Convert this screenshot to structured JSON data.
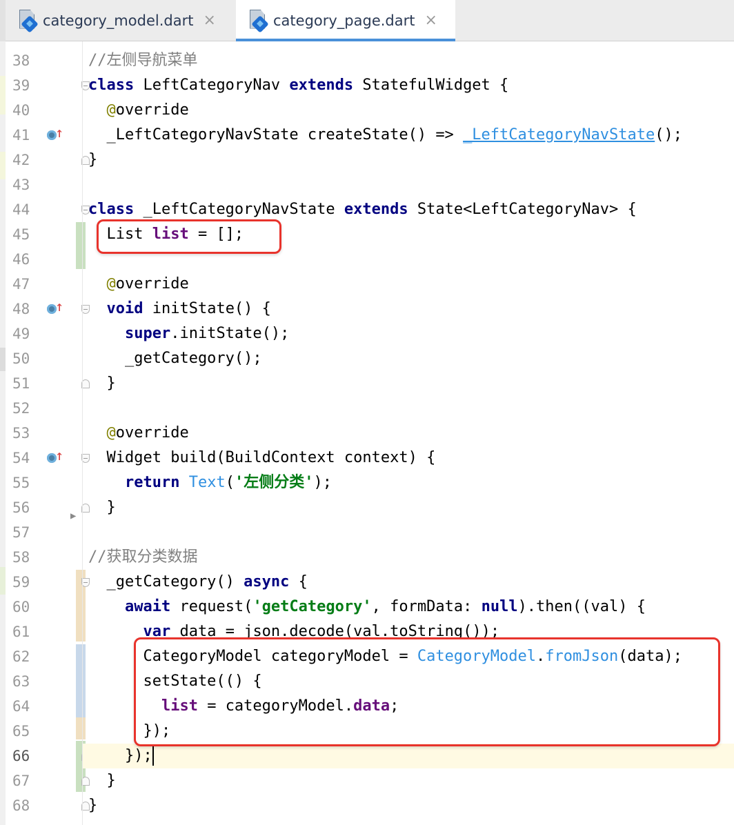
{
  "tabs": [
    {
      "label": "category_model.dart",
      "close": "×",
      "icon": "dart-file-icon",
      "active": false
    },
    {
      "label": "category_page.dart",
      "close": "×",
      "icon": "dart-file-icon",
      "active": true
    }
  ],
  "colors": {
    "keyword": "#000080",
    "comment": "#808080",
    "string": "#067d17",
    "annotation": "#808000",
    "field": "#660e7a",
    "link": "#2f8fe0",
    "highlight_box": "#e8332c",
    "current_line": "#fffae3",
    "tab_underline": "#4a90d9"
  },
  "current_line": 66,
  "highlight_boxes": [
    {
      "lines": [
        45,
        45
      ],
      "note": "List list = [];"
    },
    {
      "lines": [
        62,
        65
      ],
      "note": "setState block"
    }
  ],
  "gutter_markers": [
    41,
    48,
    54
  ],
  "lines": [
    {
      "n": "38",
      "segs": [
        {
          "t": "//左侧导航菜单",
          "c": "com"
        }
      ]
    },
    {
      "n": "39",
      "segs": [
        {
          "t": "class",
          "c": "kw"
        },
        {
          "t": " LeftCategoryNav "
        },
        {
          "t": "extends",
          "c": "kw"
        },
        {
          "t": " StatefulWidget {"
        }
      ]
    },
    {
      "n": "40",
      "segs": [
        {
          "t": "  "
        },
        {
          "t": "@",
          "c": "ann"
        },
        {
          "t": "override"
        }
      ]
    },
    {
      "n": "41",
      "segs": [
        {
          "t": "  _LeftCategoryNavState createState() => "
        },
        {
          "t": "_LeftCategoryNavState",
          "c": "linku"
        },
        {
          "t": "();"
        }
      ]
    },
    {
      "n": "42",
      "segs": [
        {
          "t": "}"
        }
      ]
    },
    {
      "n": "43",
      "segs": []
    },
    {
      "n": "44",
      "segs": [
        {
          "t": "class",
          "c": "kw"
        },
        {
          "t": " _LeftCategoryNavState "
        },
        {
          "t": "extends",
          "c": "kw"
        },
        {
          "t": " State<LeftCategoryNav> {"
        }
      ]
    },
    {
      "n": "45",
      "segs": [
        {
          "t": "  List "
        },
        {
          "t": "list",
          "c": "fld"
        },
        {
          "t": " = [];"
        }
      ]
    },
    {
      "n": "46",
      "segs": []
    },
    {
      "n": "47",
      "segs": [
        {
          "t": "  "
        },
        {
          "t": "@",
          "c": "ann"
        },
        {
          "t": "override"
        }
      ]
    },
    {
      "n": "48",
      "segs": [
        {
          "t": "  "
        },
        {
          "t": "void",
          "c": "kw"
        },
        {
          "t": " initState() {"
        }
      ]
    },
    {
      "n": "49",
      "segs": [
        {
          "t": "    "
        },
        {
          "t": "super",
          "c": "kw"
        },
        {
          "t": ".initState();"
        }
      ]
    },
    {
      "n": "50",
      "segs": [
        {
          "t": "    _getCategory();"
        }
      ]
    },
    {
      "n": "51",
      "segs": [
        {
          "t": "  }"
        }
      ]
    },
    {
      "n": "52",
      "segs": []
    },
    {
      "n": "53",
      "segs": [
        {
          "t": "  "
        },
        {
          "t": "@",
          "c": "ann"
        },
        {
          "t": "override"
        }
      ]
    },
    {
      "n": "54",
      "segs": [
        {
          "t": "  Widget build(BuildContext context) {"
        }
      ]
    },
    {
      "n": "55",
      "segs": [
        {
          "t": "    "
        },
        {
          "t": "return",
          "c": "kw"
        },
        {
          "t": " "
        },
        {
          "t": "Text",
          "c": "link"
        },
        {
          "t": "("
        },
        {
          "t": "'左侧分类'",
          "c": "str"
        },
        {
          "t": ");"
        }
      ]
    },
    {
      "n": "56",
      "segs": [
        {
          "t": "  }"
        }
      ]
    },
    {
      "n": "57",
      "segs": []
    },
    {
      "n": "58",
      "segs": [
        {
          "t": "//获取分类数据",
          "c": "com"
        }
      ]
    },
    {
      "n": "59",
      "segs": [
        {
          "t": "  _getCategory() "
        },
        {
          "t": "async",
          "c": "kw"
        },
        {
          "t": " {"
        }
      ]
    },
    {
      "n": "60",
      "segs": [
        {
          "t": "    "
        },
        {
          "t": "await",
          "c": "kw"
        },
        {
          "t": " request("
        },
        {
          "t": "'getCategory'",
          "c": "str"
        },
        {
          "t": ", formData: "
        },
        {
          "t": "null",
          "c": "kw"
        },
        {
          "t": ").then((val) {"
        }
      ]
    },
    {
      "n": "61",
      "segs": [
        {
          "t": "      "
        },
        {
          "t": "var",
          "c": "kw"
        },
        {
          "t": " data = json.decode(val.toString());"
        }
      ]
    },
    {
      "n": "62",
      "segs": [
        {
          "t": "      CategoryModel categoryModel = "
        },
        {
          "t": "CategoryModel",
          "c": "link"
        },
        {
          "t": "."
        },
        {
          "t": "fromJson",
          "c": "link"
        },
        {
          "t": "(data);"
        }
      ]
    },
    {
      "n": "63",
      "segs": [
        {
          "t": "      setState(() {"
        }
      ]
    },
    {
      "n": "64",
      "segs": [
        {
          "t": "        "
        },
        {
          "t": "list",
          "c": "fld"
        },
        {
          "t": " = categoryModel."
        },
        {
          "t": "data",
          "c": "fld"
        },
        {
          "t": ";"
        }
      ]
    },
    {
      "n": "65",
      "segs": [
        {
          "t": "      });"
        }
      ]
    },
    {
      "n": "66",
      "segs": [
        {
          "t": "    });"
        }
      ]
    },
    {
      "n": "67",
      "segs": [
        {
          "t": "  }"
        }
      ]
    },
    {
      "n": "68",
      "segs": [
        {
          "t": "}"
        }
      ]
    }
  ]
}
